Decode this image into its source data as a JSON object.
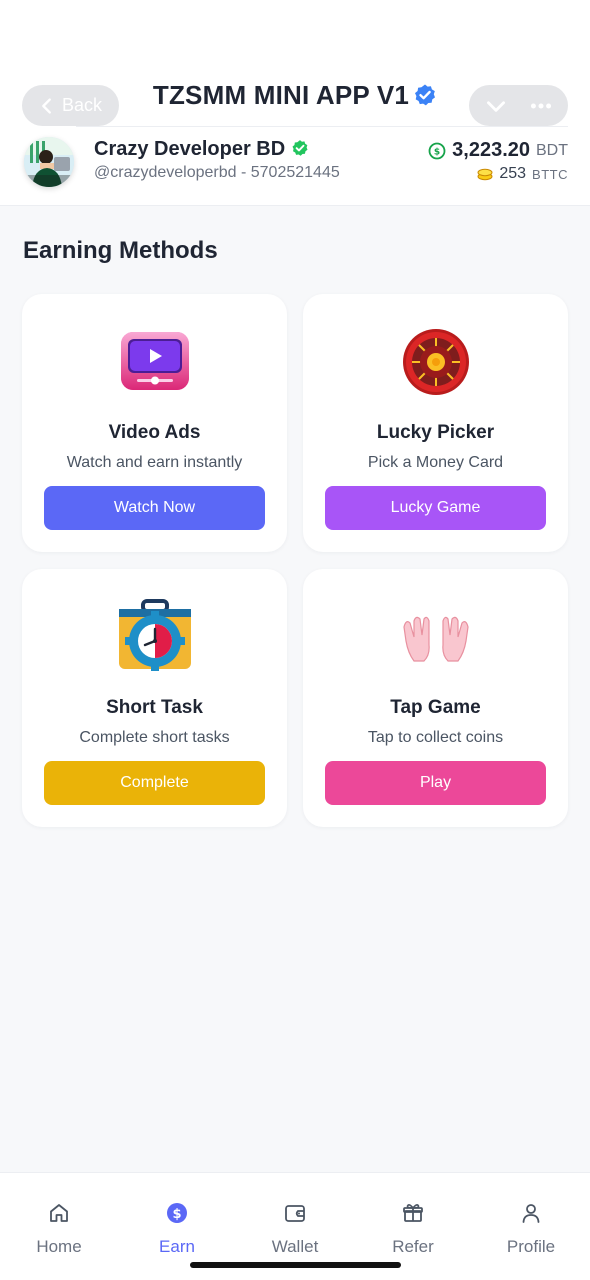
{
  "header": {
    "back_label": "Back",
    "title": "TZSMM MINI APP V1"
  },
  "user": {
    "name": "Crazy Developer BD",
    "handle": "@crazydeveloperbd - 5702521445"
  },
  "balance": {
    "main_amount": "3,223.20",
    "main_currency": "BDT",
    "sub_amount": "253",
    "sub_currency": "BTTC"
  },
  "section_title": "Earning Methods",
  "cards": [
    {
      "title": "Video Ads",
      "desc": "Watch and earn instantly",
      "button": "Watch Now",
      "color": "#5b68f6",
      "icon": "video-player-icon"
    },
    {
      "title": "Lucky Picker",
      "desc": "Pick a Money Card",
      "button": "Lucky Game",
      "color": "#a855f7",
      "icon": "roulette-wheel-icon"
    },
    {
      "title": "Short Task",
      "desc": "Complete short tasks",
      "button": "Complete",
      "color": "#eab308",
      "icon": "task-briefcase-clock-icon"
    },
    {
      "title": "Tap Game",
      "desc": "Tap to collect coins",
      "button": "Play",
      "color": "#ec4899",
      "icon": "raised-hands-icon"
    }
  ],
  "nav": [
    {
      "label": "Home",
      "icon": "home-icon",
      "active": false
    },
    {
      "label": "Earn",
      "icon": "dollar-coin-icon",
      "active": true
    },
    {
      "label": "Wallet",
      "icon": "wallet-icon",
      "active": false
    },
    {
      "label": "Refer",
      "icon": "gift-icon",
      "active": false
    },
    {
      "label": "Profile",
      "icon": "user-icon",
      "active": false
    }
  ],
  "colors": {
    "accent": "#5b68f6",
    "verified_blue": "#3b82f6",
    "verified_green": "#22c55e"
  }
}
